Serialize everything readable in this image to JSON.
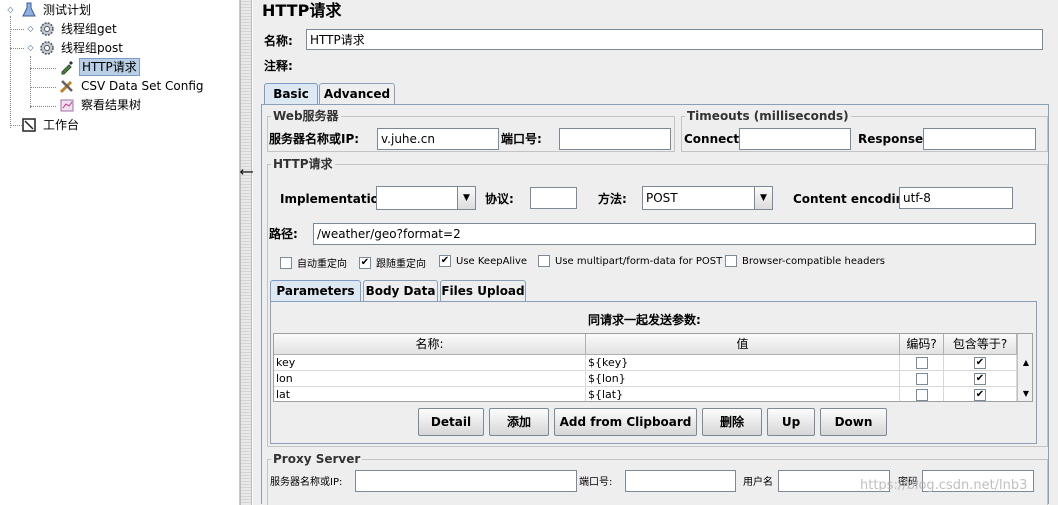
{
  "tree": {
    "items": [
      {
        "label": "测试计划"
      },
      {
        "label": "线程组get"
      },
      {
        "label": "线程组post"
      },
      {
        "label": "HTTP请求"
      },
      {
        "label": "CSV Data Set Config"
      },
      {
        "label": "察看结果树"
      },
      {
        "label": "工作台"
      }
    ]
  },
  "panel": {
    "title": "HTTP请求",
    "name_label": "名称:",
    "name_value": "HTTP请求",
    "comment_label": "注释:",
    "comment_value": ""
  },
  "tabs": {
    "basic": "Basic",
    "advanced": "Advanced",
    "active": "Basic"
  },
  "web_server": {
    "title": "Web服务器",
    "server_label": "服务器名称或IP:",
    "server_value": "v.juhe.cn",
    "port_label": "端口号:",
    "port_value": ""
  },
  "timeouts": {
    "title": "Timeouts (milliseconds)",
    "connect_label": "Connect:",
    "connect_value": "",
    "response_label": "Response:",
    "response_value": ""
  },
  "http_request": {
    "title": "HTTP请求",
    "impl_label": "Implementation:",
    "impl_value": "",
    "protocol_label": "协议:",
    "protocol_value": "",
    "method_label": "方法:",
    "method_value": "POST",
    "encoding_label": "Content encoding:",
    "encoding_value": "utf-8",
    "path_label": "路径:",
    "path_value": "/weather/geo?format=2",
    "checkboxes": [
      {
        "label": "自动重定向",
        "checked": false
      },
      {
        "label": "跟随重定向",
        "checked": true
      },
      {
        "label": "Use KeepAlive",
        "checked": true
      },
      {
        "label": "Use multipart/form-data for POST",
        "checked": false
      },
      {
        "label": "Browser-compatible headers",
        "checked": false
      }
    ]
  },
  "subtabs": {
    "parameters": "Parameters",
    "body_data": "Body Data",
    "files_upload": "Files Upload",
    "active": "Parameters"
  },
  "params": {
    "caption": "同请求一起发送参数:",
    "headers": [
      "名称:",
      "值",
      "编码?",
      "包含等于?"
    ],
    "rows": [
      {
        "name": "key",
        "value": "${key}",
        "encode": false,
        "include_equals": true
      },
      {
        "name": "lon",
        "value": "${lon}",
        "encode": false,
        "include_equals": true
      },
      {
        "name": "lat",
        "value": "${lat}",
        "encode": false,
        "include_equals": true
      }
    ]
  },
  "buttons": {
    "detail": "Detail",
    "add": "添加",
    "add_clipboard": "Add from Clipboard",
    "delete": "删除",
    "up": "Up",
    "down": "Down"
  },
  "proxy": {
    "title": "Proxy Server",
    "server_label": "服务器名称或IP:",
    "server_value": "",
    "port_label": "端口号:",
    "port_value": "",
    "user_label": "用户名",
    "user_value": "",
    "password_label": "密码",
    "password_value": ""
  },
  "watermark": "https://blog.csdn.net/lnb3"
}
